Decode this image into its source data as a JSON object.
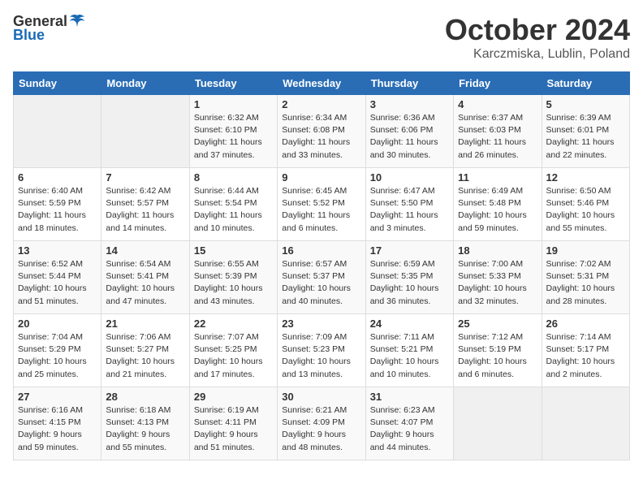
{
  "header": {
    "logo_general": "General",
    "logo_blue": "Blue",
    "month": "October 2024",
    "location": "Karczmiska, Lublin, Poland"
  },
  "days_of_week": [
    "Sunday",
    "Monday",
    "Tuesday",
    "Wednesday",
    "Thursday",
    "Friday",
    "Saturday"
  ],
  "weeks": [
    [
      {
        "day": "",
        "info": ""
      },
      {
        "day": "",
        "info": ""
      },
      {
        "day": "1",
        "info": "Sunrise: 6:32 AM\nSunset: 6:10 PM\nDaylight: 11 hours and 37 minutes."
      },
      {
        "day": "2",
        "info": "Sunrise: 6:34 AM\nSunset: 6:08 PM\nDaylight: 11 hours and 33 minutes."
      },
      {
        "day": "3",
        "info": "Sunrise: 6:36 AM\nSunset: 6:06 PM\nDaylight: 11 hours and 30 minutes."
      },
      {
        "day": "4",
        "info": "Sunrise: 6:37 AM\nSunset: 6:03 PM\nDaylight: 11 hours and 26 minutes."
      },
      {
        "day": "5",
        "info": "Sunrise: 6:39 AM\nSunset: 6:01 PM\nDaylight: 11 hours and 22 minutes."
      }
    ],
    [
      {
        "day": "6",
        "info": "Sunrise: 6:40 AM\nSunset: 5:59 PM\nDaylight: 11 hours and 18 minutes."
      },
      {
        "day": "7",
        "info": "Sunrise: 6:42 AM\nSunset: 5:57 PM\nDaylight: 11 hours and 14 minutes."
      },
      {
        "day": "8",
        "info": "Sunrise: 6:44 AM\nSunset: 5:54 PM\nDaylight: 11 hours and 10 minutes."
      },
      {
        "day": "9",
        "info": "Sunrise: 6:45 AM\nSunset: 5:52 PM\nDaylight: 11 hours and 6 minutes."
      },
      {
        "day": "10",
        "info": "Sunrise: 6:47 AM\nSunset: 5:50 PM\nDaylight: 11 hours and 3 minutes."
      },
      {
        "day": "11",
        "info": "Sunrise: 6:49 AM\nSunset: 5:48 PM\nDaylight: 10 hours and 59 minutes."
      },
      {
        "day": "12",
        "info": "Sunrise: 6:50 AM\nSunset: 5:46 PM\nDaylight: 10 hours and 55 minutes."
      }
    ],
    [
      {
        "day": "13",
        "info": "Sunrise: 6:52 AM\nSunset: 5:44 PM\nDaylight: 10 hours and 51 minutes."
      },
      {
        "day": "14",
        "info": "Sunrise: 6:54 AM\nSunset: 5:41 PM\nDaylight: 10 hours and 47 minutes."
      },
      {
        "day": "15",
        "info": "Sunrise: 6:55 AM\nSunset: 5:39 PM\nDaylight: 10 hours and 43 minutes."
      },
      {
        "day": "16",
        "info": "Sunrise: 6:57 AM\nSunset: 5:37 PM\nDaylight: 10 hours and 40 minutes."
      },
      {
        "day": "17",
        "info": "Sunrise: 6:59 AM\nSunset: 5:35 PM\nDaylight: 10 hours and 36 minutes."
      },
      {
        "day": "18",
        "info": "Sunrise: 7:00 AM\nSunset: 5:33 PM\nDaylight: 10 hours and 32 minutes."
      },
      {
        "day": "19",
        "info": "Sunrise: 7:02 AM\nSunset: 5:31 PM\nDaylight: 10 hours and 28 minutes."
      }
    ],
    [
      {
        "day": "20",
        "info": "Sunrise: 7:04 AM\nSunset: 5:29 PM\nDaylight: 10 hours and 25 minutes."
      },
      {
        "day": "21",
        "info": "Sunrise: 7:06 AM\nSunset: 5:27 PM\nDaylight: 10 hours and 21 minutes."
      },
      {
        "day": "22",
        "info": "Sunrise: 7:07 AM\nSunset: 5:25 PM\nDaylight: 10 hours and 17 minutes."
      },
      {
        "day": "23",
        "info": "Sunrise: 7:09 AM\nSunset: 5:23 PM\nDaylight: 10 hours and 13 minutes."
      },
      {
        "day": "24",
        "info": "Sunrise: 7:11 AM\nSunset: 5:21 PM\nDaylight: 10 hours and 10 minutes."
      },
      {
        "day": "25",
        "info": "Sunrise: 7:12 AM\nSunset: 5:19 PM\nDaylight: 10 hours and 6 minutes."
      },
      {
        "day": "26",
        "info": "Sunrise: 7:14 AM\nSunset: 5:17 PM\nDaylight: 10 hours and 2 minutes."
      }
    ],
    [
      {
        "day": "27",
        "info": "Sunrise: 6:16 AM\nSunset: 4:15 PM\nDaylight: 9 hours and 59 minutes."
      },
      {
        "day": "28",
        "info": "Sunrise: 6:18 AM\nSunset: 4:13 PM\nDaylight: 9 hours and 55 minutes."
      },
      {
        "day": "29",
        "info": "Sunrise: 6:19 AM\nSunset: 4:11 PM\nDaylight: 9 hours and 51 minutes."
      },
      {
        "day": "30",
        "info": "Sunrise: 6:21 AM\nSunset: 4:09 PM\nDaylight: 9 hours and 48 minutes."
      },
      {
        "day": "31",
        "info": "Sunrise: 6:23 AM\nSunset: 4:07 PM\nDaylight: 9 hours and 44 minutes."
      },
      {
        "day": "",
        "info": ""
      },
      {
        "day": "",
        "info": ""
      }
    ]
  ]
}
